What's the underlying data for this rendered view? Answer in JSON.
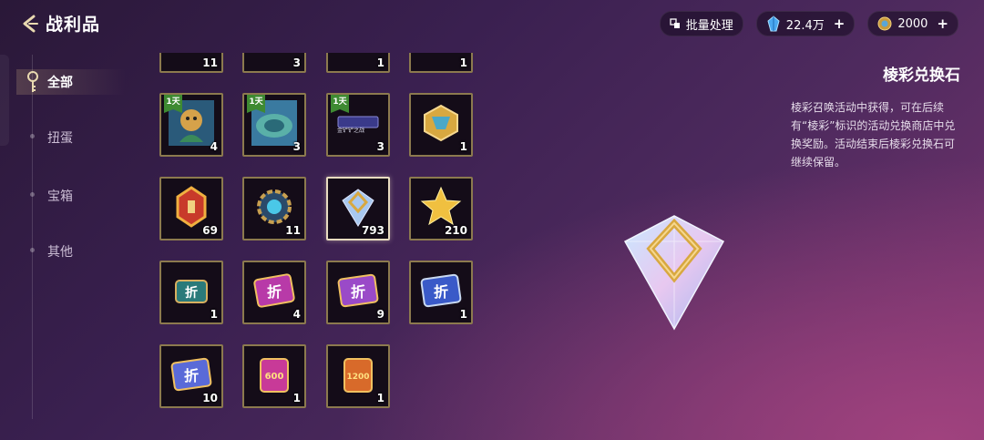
{
  "header": {
    "title": "战利品",
    "batch_label": "批量处理",
    "gems": "22.4万",
    "coins": "2000"
  },
  "sidebar": {
    "items": [
      {
        "label": "全部",
        "active": true
      },
      {
        "label": "扭蛋",
        "active": false
      },
      {
        "label": "宝箱",
        "active": false
      },
      {
        "label": "其他",
        "active": false
      }
    ]
  },
  "grid": {
    "partial_row": [
      "11",
      "3",
      "1",
      "1"
    ],
    "rows": [
      [
        {
          "count": "4",
          "tag": "1天"
        },
        {
          "count": "3",
          "tag": "1天"
        },
        {
          "count": "3",
          "tag": "1天",
          "label": "金铲铲之战"
        },
        {
          "count": "1"
        }
      ],
      [
        {
          "count": "69"
        },
        {
          "count": "11"
        },
        {
          "count": "793",
          "selected": true
        },
        {
          "count": "210"
        }
      ],
      [
        {
          "count": "1",
          "glyph": "折"
        },
        {
          "count": "4",
          "glyph": "折"
        },
        {
          "count": "9",
          "glyph": "折"
        },
        {
          "count": "1",
          "glyph": "折"
        }
      ],
      [
        {
          "count": "10",
          "glyph": "折"
        },
        {
          "count": "1",
          "glyph": "600"
        },
        {
          "count": "1",
          "glyph": "1200"
        }
      ]
    ]
  },
  "detail": {
    "name": "棱彩兑换石",
    "description": "棱彩召唤活动中获得，可在后续有“棱彩”标识的活动兑换商店中兑换奖励。活动结束后棱彩兑换石可继续保留。"
  },
  "colors": {
    "frame": "#8c7a4e",
    "tag_green": "#3e8a32",
    "gold": "#d8a840"
  }
}
